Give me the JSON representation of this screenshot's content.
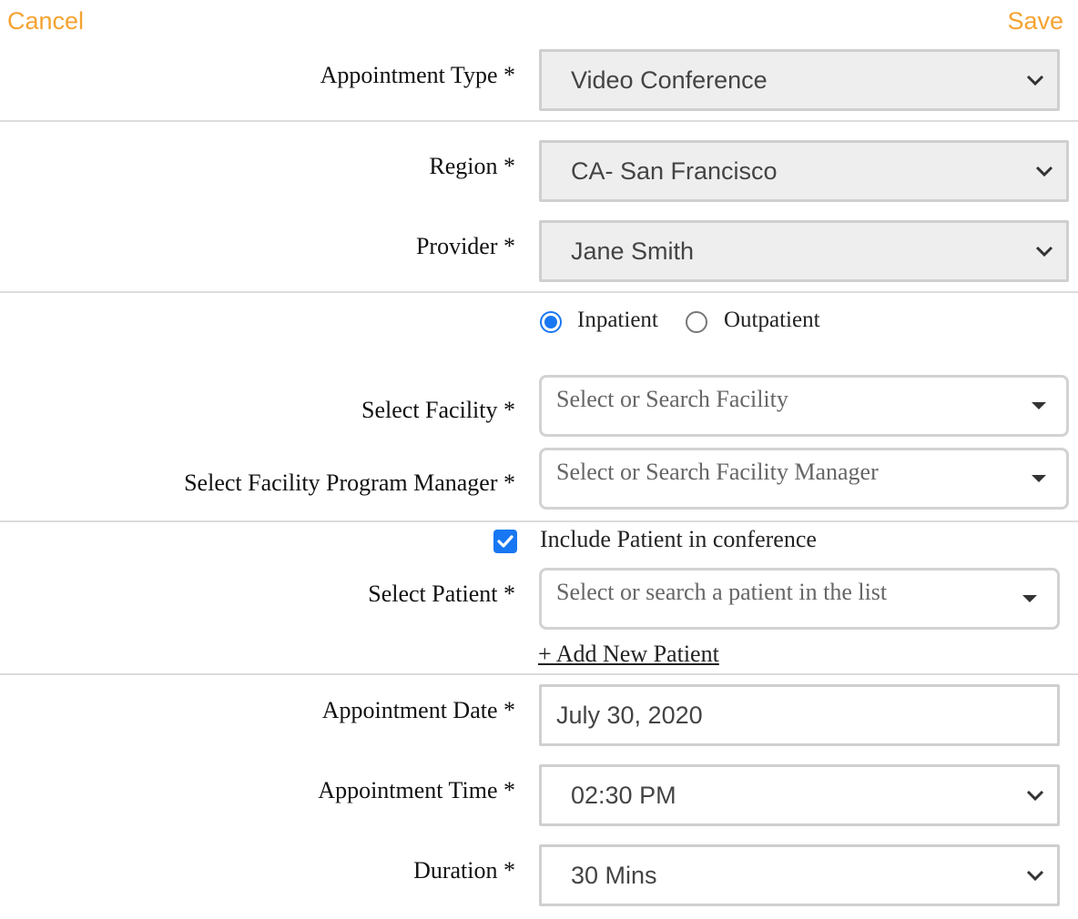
{
  "header": {
    "cancel_label": "Cancel",
    "save_label": "Save"
  },
  "appointment_type": {
    "label": "Appointment Type *",
    "value": "Video Conference"
  },
  "region": {
    "label": "Region *",
    "value": "CA- San Francisco"
  },
  "provider": {
    "label": "Provider *",
    "value": "Jane Smith"
  },
  "patient_type": {
    "options": [
      "Inpatient",
      "Outpatient"
    ],
    "selected": "Inpatient"
  },
  "facility": {
    "label": "Select Facility *",
    "placeholder": "Select or Search Facility"
  },
  "facility_manager": {
    "label": "Select Facility Program Manager *",
    "placeholder": "Select or Search Facility Manager"
  },
  "include_patient": {
    "label": "Include Patient in conference",
    "checked": true
  },
  "patient": {
    "label": "Select Patient *",
    "placeholder": "Select or search a patient in the list",
    "add_link": "+ Add New Patient"
  },
  "appointment_date": {
    "label": "Appointment Date *",
    "value": "July 30, 2020"
  },
  "appointment_time": {
    "label": "Appointment Time *",
    "value": "02:30 PM"
  },
  "duration": {
    "label": "Duration *",
    "value": "30 Mins"
  },
  "colors": {
    "accent": "#f5a331",
    "control_blue": "#1877f2"
  }
}
